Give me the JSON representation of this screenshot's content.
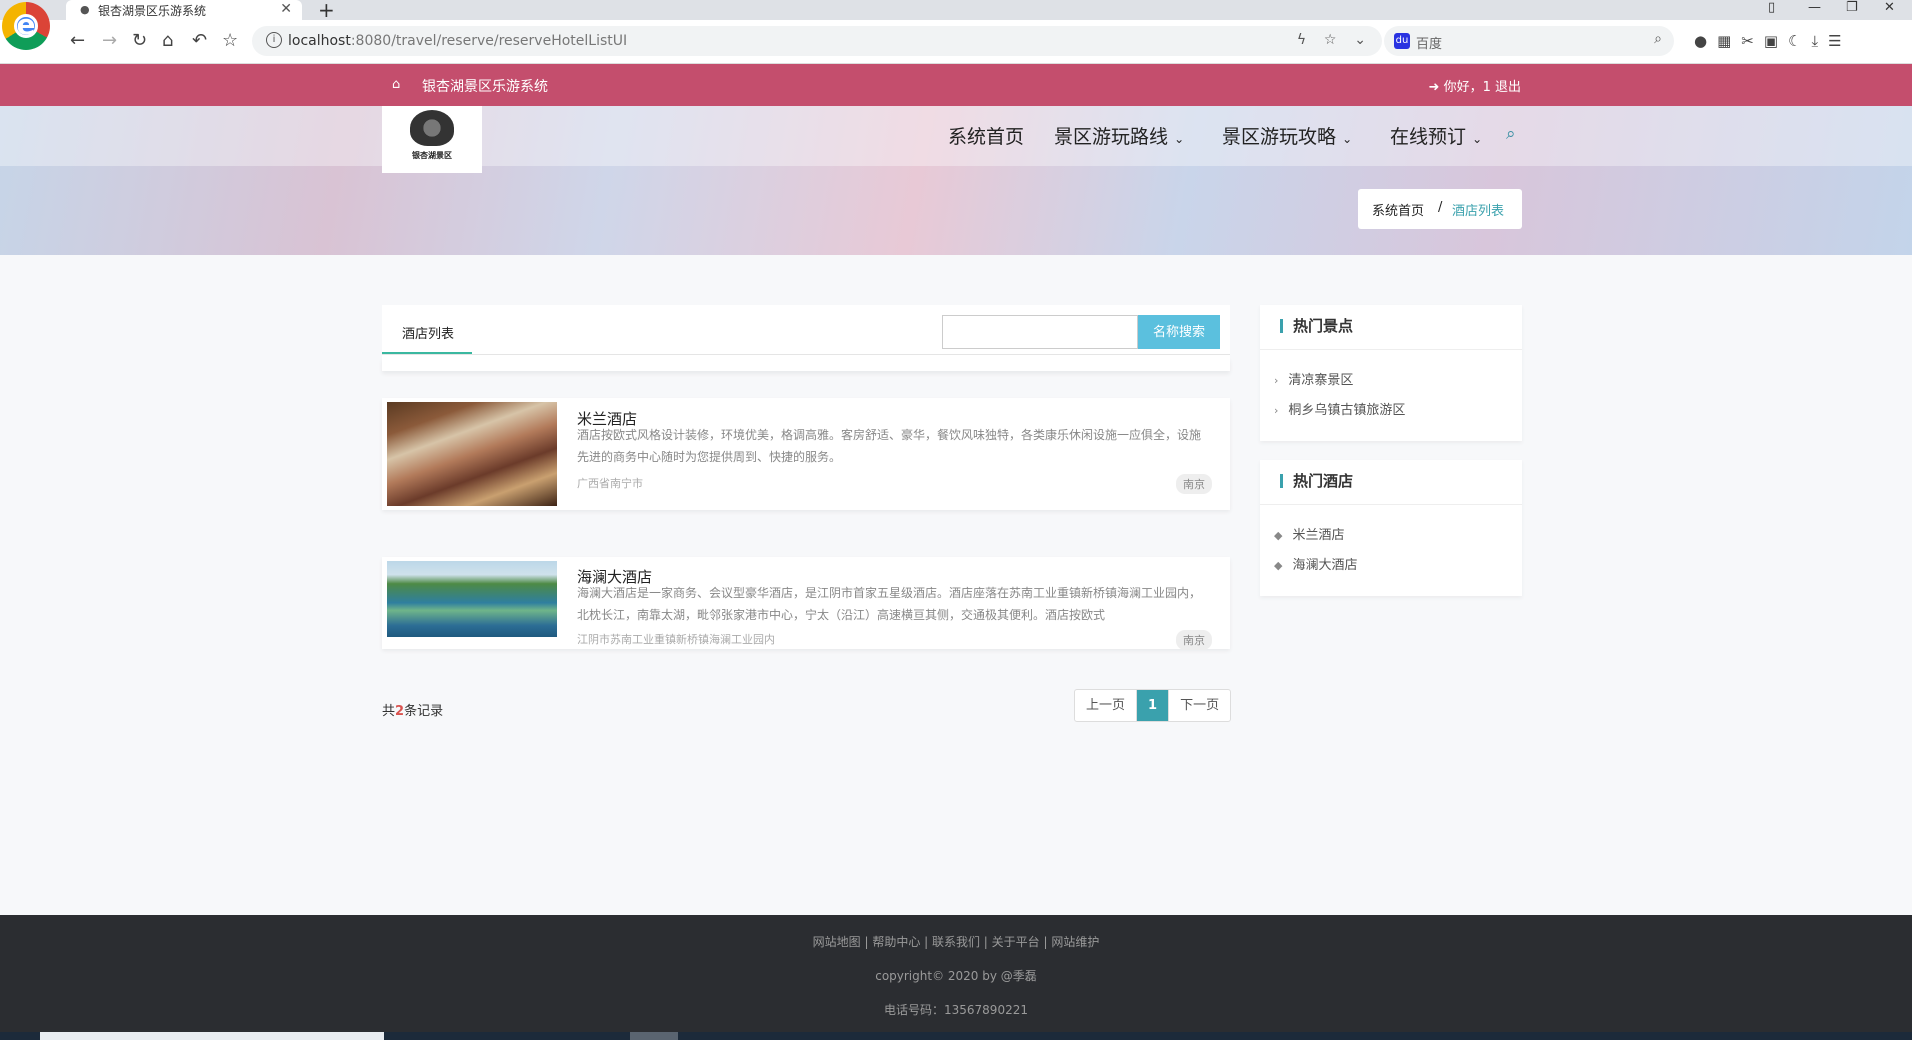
{
  "browser": {
    "tab_title": "银杏湖景区乐游系统",
    "url_host": "localhost",
    "url_rest": ":8080/travel/reserve/reserveHotelListUI",
    "search_placeholder": "百度"
  },
  "topbar": {
    "brand": "银杏湖景区乐游系统",
    "user_text": "你好，1  退出"
  },
  "nav": {
    "logo_text": "银杏湖景区",
    "items": [
      {
        "label": "系统首页"
      },
      {
        "label": "景区游玩路线"
      },
      {
        "label": "景区游玩攻略"
      },
      {
        "label": "在线预订"
      }
    ]
  },
  "breadcrumb": {
    "home": "系统首页",
    "sep": "/",
    "current": "酒店列表"
  },
  "list": {
    "tab_label": "酒店列表",
    "search_button": "名称搜索",
    "search_value": "",
    "hotels": [
      {
        "name": "米兰酒店",
        "desc": "酒店按欧式风格设计装修，环境优美，格调高雅。客房舒适、豪华，餐饮风味独特，各类康乐休闲设施一应俱全，设施先进的商务中心随时为您提供周到、快捷的服务。",
        "addr": "广西省南宁市",
        "tag": "南京"
      },
      {
        "name": "海澜大酒店",
        "desc": "海澜大酒店是一家商务、会议型豪华酒店，是江阴市首家五星级酒店。酒店座落在苏南工业重镇新桥镇海澜工业园内，北枕长江，南靠太湖，毗邻张家港市中心，宁太（沿江）高速横亘其侧，交通极其便利。酒店按欧式",
        "addr": "江阴市苏南工业重镇新桥镇海澜工业园内",
        "tag": "南京"
      }
    ],
    "total_prefix": "共",
    "total_count": "2",
    "total_suffix": "条记录",
    "pager": {
      "prev": "上一页",
      "current": "1",
      "next": "下一页"
    }
  },
  "sidebar": {
    "spots_title": "热门景点",
    "spots": [
      "清凉寨景区",
      "桐乡乌镇古镇旅游区"
    ],
    "hotels_title": "热门酒店",
    "hotels": [
      "米兰酒店",
      "海澜大酒店"
    ]
  },
  "footer": {
    "links": "网站地图 | 帮助中心 | 联系我们 | 关于平台 | 网站维护",
    "copyright": "copyright© 2020 by @季磊",
    "phone": "电话号码：13567890221"
  },
  "colors": {
    "topbar": "#c44e6d",
    "accent": "#3aa1ad",
    "search_button": "#5bc0de",
    "footer": "#2b2d31"
  }
}
